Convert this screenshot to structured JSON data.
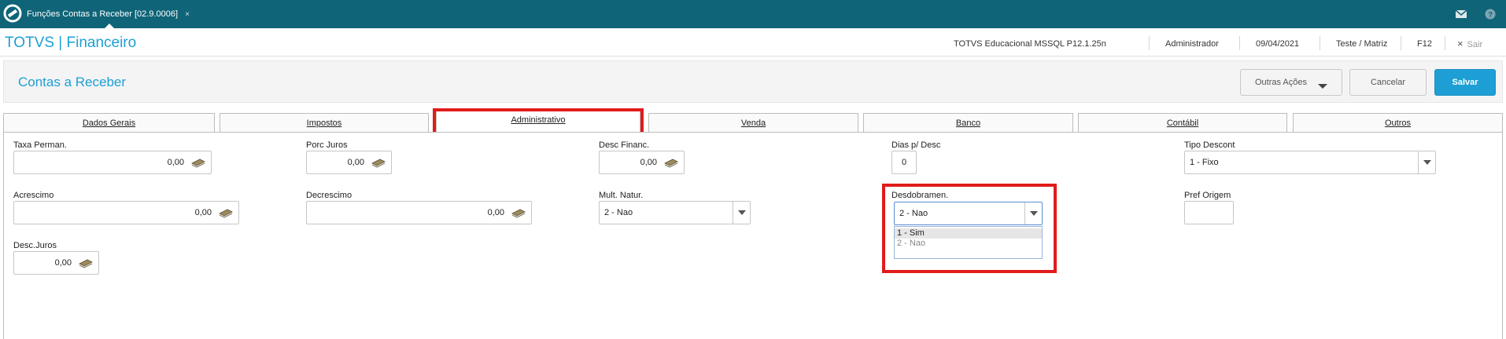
{
  "topbar": {
    "tab_label": "Funções Contas a Receber [02.9.0006]",
    "tab_close": "×",
    "icons": [
      "totvs-logo-icon",
      "mail-icon",
      "help-icon"
    ],
    "color": "#0f6478"
  },
  "header": {
    "brand": "TOTVS | Financeiro",
    "environment": "TOTVS Educacional MSSQL P12.1.25n",
    "user": "Administrador",
    "date": "09/04/2021",
    "company": "Teste / Matriz",
    "shortcut": "F12",
    "exit_label": "Sair",
    "exit_icon": "×"
  },
  "page": {
    "title": "Contas a Receber",
    "buttons": {
      "other_actions": "Outras Ações",
      "cancel": "Cancelar",
      "save": "Salvar"
    }
  },
  "tabs": [
    {
      "label": "Dados Gerais",
      "active": false
    },
    {
      "label": "Impostos",
      "active": false
    },
    {
      "label": "Administrativo",
      "active": true
    },
    {
      "label": "Venda",
      "active": false
    },
    {
      "label": "Banco",
      "active": false
    },
    {
      "label": "Contábil",
      "active": false
    },
    {
      "label": "Outros",
      "active": false
    }
  ],
  "fields": {
    "taxa_perman": {
      "label": "Taxa Perman.",
      "value": "0,00"
    },
    "porc_juros": {
      "label": "Porc Juros",
      "value": "0,00"
    },
    "desc_financ": {
      "label": "Desc Financ.",
      "value": "0,00"
    },
    "dias_desc": {
      "label": "Dias p/ Desc",
      "value": "0"
    },
    "tipo_descont": {
      "label": "Tipo Descont",
      "value": "1 - Fixo"
    },
    "acrescimo": {
      "label": "Acrescimo",
      "value": "0,00"
    },
    "decrescimo": {
      "label": "Decrescimo",
      "value": "0,00"
    },
    "mult_natur": {
      "label": "Mult. Natur.",
      "value": "2 - Nao"
    },
    "desdobramen": {
      "label": "Desdobramen.",
      "value": "2 - Nao",
      "options": [
        "1 - Sim",
        "2 - Nao"
      ]
    },
    "pref_origem": {
      "label": "Pref Origem",
      "value": ""
    },
    "desc_juros": {
      "label": "Desc.Juros",
      "value": "0,00"
    }
  },
  "colors": {
    "brand_blue": "#1d9fd5",
    "highlight_red": "#e11b1b"
  }
}
